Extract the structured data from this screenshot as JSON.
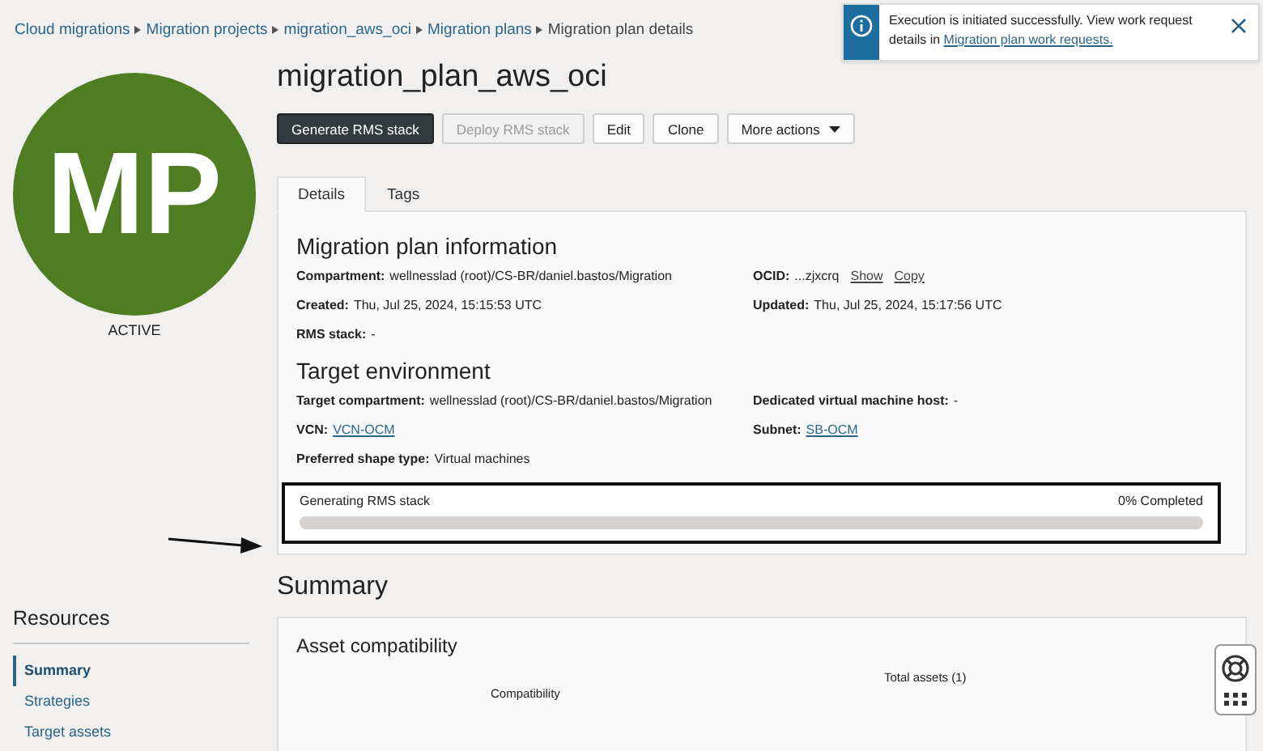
{
  "breadcrumbs": [
    {
      "label": "Cloud migrations",
      "link": true
    },
    {
      "label": "Migration projects",
      "link": true
    },
    {
      "label": "migration_aws_oci",
      "link": true
    },
    {
      "label": "Migration plans",
      "link": true
    },
    {
      "label": "Migration plan details",
      "link": false
    }
  ],
  "avatar": {
    "initials": "MP",
    "status": "ACTIVE"
  },
  "title": "migration_plan_aws_oci",
  "buttons": [
    {
      "label": "Generate RMS stack",
      "kind": "primary",
      "disabled": false
    },
    {
      "label": "Deploy RMS stack",
      "kind": "plain",
      "disabled": true
    },
    {
      "label": "Edit",
      "kind": "plain",
      "disabled": false
    },
    {
      "label": "Clone",
      "kind": "plain",
      "disabled": false
    },
    {
      "label": "More actions",
      "kind": "menu",
      "disabled": false
    }
  ],
  "tabs": [
    {
      "label": "Details",
      "selected": true
    },
    {
      "label": "Tags",
      "selected": false
    }
  ],
  "sections": [
    {
      "heading": "Migration plan information",
      "fields": [
        {
          "label": "Compartment:",
          "value": "wellnesslad (root)/CS-BR/daniel.bastos/Migration"
        },
        {
          "label": "OCID:",
          "value": "...zjxcrq",
          "actions": [
            "Show",
            "Copy"
          ]
        },
        {
          "label": "Created:",
          "value": "Thu, Jul 25, 2024, 15:15:53 UTC"
        },
        {
          "label": "Updated:",
          "value": "Thu, Jul 25, 2024, 15:17:56 UTC"
        },
        {
          "label": "RMS stack:",
          "value": "-"
        }
      ]
    },
    {
      "heading": "Target environment",
      "fields": [
        {
          "label": "Target compartment:",
          "value": "wellnesslad (root)/CS-BR/daniel.bastos/Migration"
        },
        {
          "label": "Dedicated virtual machine host:",
          "value": "-"
        },
        {
          "label": "VCN:",
          "link": "VCN-OCM"
        },
        {
          "label": "Subnet:",
          "link": "SB-OCM"
        },
        {
          "label": "Preferred shape type:",
          "value": "Virtual machines"
        }
      ]
    }
  ],
  "progress": {
    "label": "Generating RMS stack",
    "reading": "0% Completed",
    "level": 0
  },
  "resources": {
    "heading": "Resources",
    "items": [
      {
        "label": "Summary",
        "selected": true
      },
      {
        "label": "Strategies",
        "selected": false
      },
      {
        "label": "Target assets",
        "selected": false
      }
    ]
  },
  "summary": {
    "heading": "Summary",
    "card_title": "Asset compatibility",
    "column_1": "Compatibility",
    "column_2": "Total assets (1)"
  },
  "toast": {
    "message": "Execution is initiated successfully. View work request details in ",
    "link": "Migration plan work requests."
  }
}
